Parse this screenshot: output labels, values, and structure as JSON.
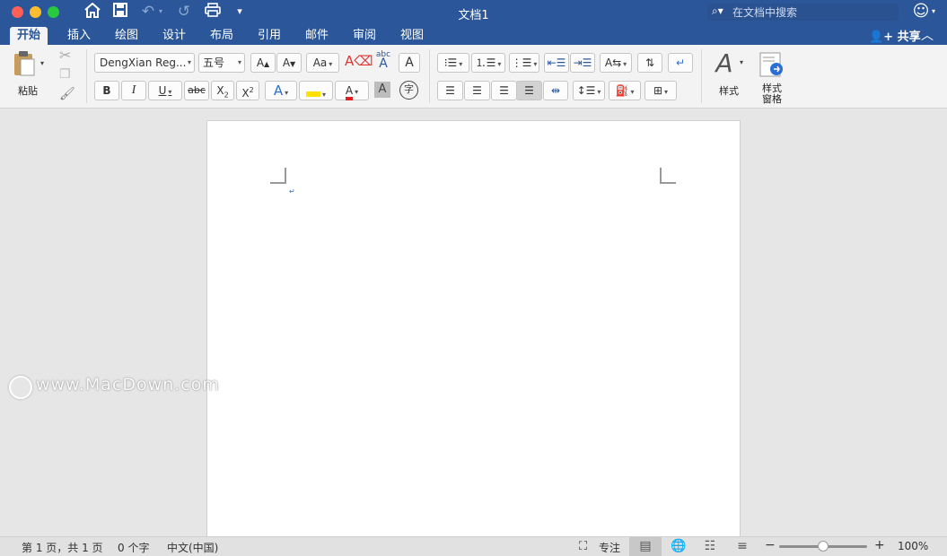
{
  "window": {
    "title": "文档1",
    "traffic_light_colors": [
      "#fe5f57",
      "#febc2e",
      "#28c840"
    ]
  },
  "titlebar": {
    "icons": [
      "home-icon",
      "save-icon",
      "undo-icon",
      "redo-icon",
      "print-icon",
      "customize-toolbar-icon"
    ],
    "search_placeholder": "在文档中搜索",
    "account_icon": "smiley-icon"
  },
  "tabs": [
    "开始",
    "插入",
    "绘图",
    "设计",
    "布局",
    "引用",
    "邮件",
    "审阅",
    "视图"
  ],
  "active_tab": "开始",
  "share_label": "共享",
  "ribbon": {
    "clipboard": {
      "paste_label": "粘贴"
    },
    "font": {
      "font_name": "DengXian Reg...",
      "font_size": "五号",
      "bold": "B",
      "italic": "I",
      "underline": "U",
      "strikethrough": "abc",
      "subscript_base": "X",
      "subscript_mark": "2",
      "superscript_base": "X",
      "superscript_mark": "2",
      "grow_font": "A",
      "shrink_font": "A",
      "change_case": "Aa",
      "phonetic_top": "abc",
      "phonetic_bottom": "A",
      "char_border": "A",
      "text_effects": "A",
      "font_color_letter": "A",
      "char_shading": "A",
      "enclose_char": "字",
      "highlight_color": "#ffe100",
      "font_color": "#e02020"
    },
    "styles": {
      "styles_label": "样式",
      "pane_label_line1": "样式",
      "pane_label_line2": "窗格"
    }
  },
  "status": {
    "page": "第 1 页，共 1 页",
    "words": "0 个字",
    "language": "中文(中国)",
    "focus": "专注",
    "zoom": "100%",
    "zoom_level": 0.5
  },
  "watermark": "www.MacDown.com",
  "accent_color": "#2b579a"
}
